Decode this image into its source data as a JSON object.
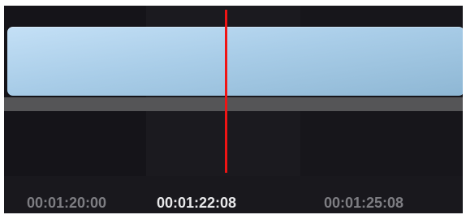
{
  "timeline": {
    "clip_color": "#a9cde8",
    "playhead_color": "#f01414",
    "timecodes": {
      "left": "00:01:20:00",
      "current": "00:01:22:08",
      "right": "00:01:25:08"
    },
    "timecode_colors": {
      "inactive": "#7d7d82",
      "current": "#e8e8ea"
    }
  }
}
